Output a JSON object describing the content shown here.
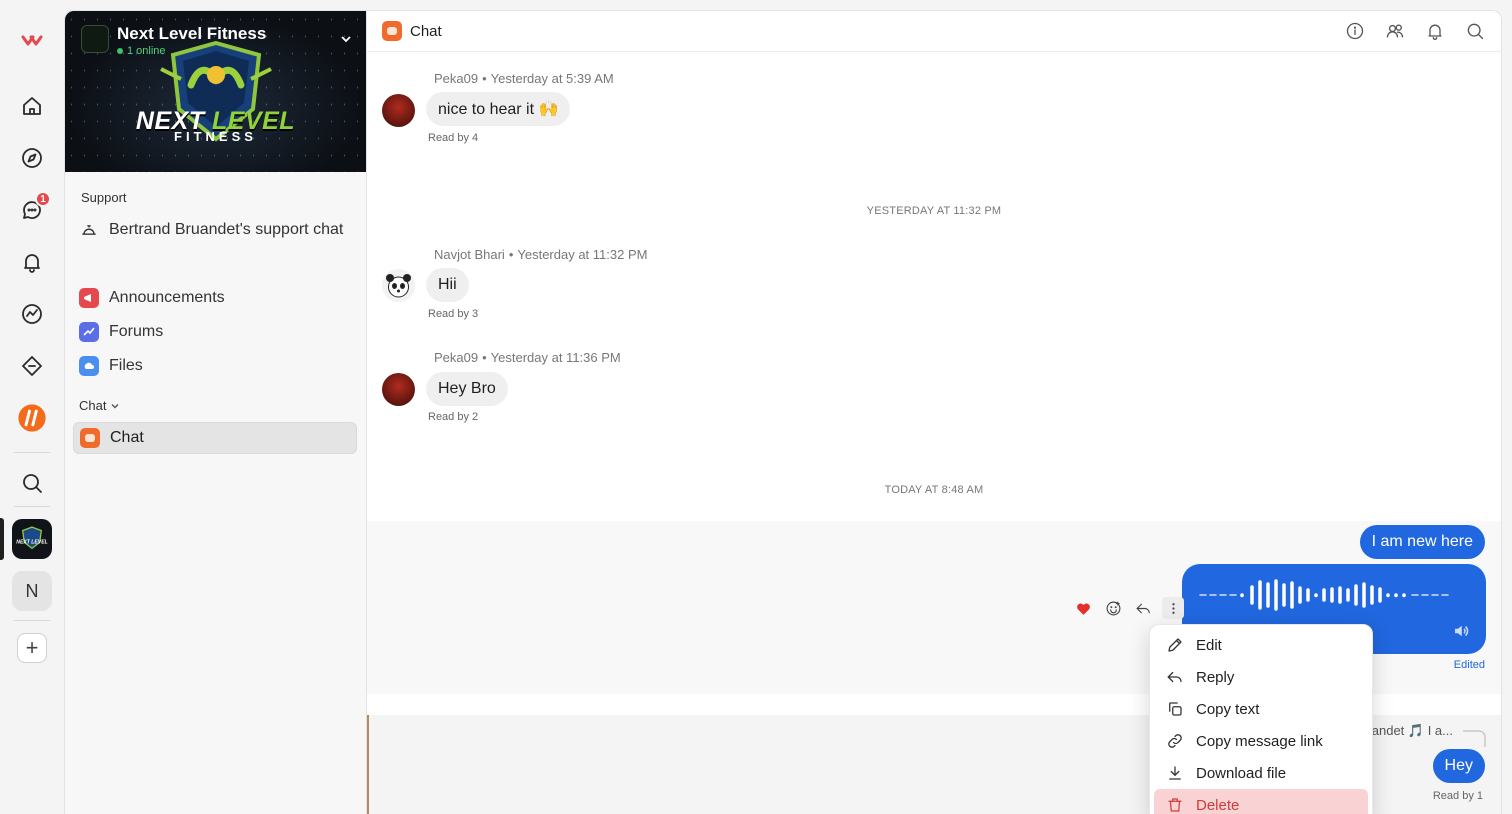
{
  "rail": {
    "notification_count": "1",
    "server_letter": "N",
    "add_label": "+"
  },
  "server": {
    "name": "Next Level Fitness",
    "online": "1 online",
    "logo_line1_a": "NEXT ",
    "logo_line1_b": "LEVEL",
    "logo_line2": "FITNESS"
  },
  "sidebar": {
    "support_label": "Support",
    "support_chat": "Bertrand Bruandet's support chat",
    "channels": [
      {
        "label": "Announcements",
        "icon": "megaphone-icon",
        "color": "#e5484d"
      },
      {
        "label": "Forums",
        "icon": "forum-icon",
        "color": "#5b6ee8"
      },
      {
        "label": "Files",
        "icon": "cloud-icon",
        "color": "#4a8ff0"
      }
    ],
    "chat_group": "Chat",
    "chat_item": "Chat"
  },
  "header": {
    "title": "Chat"
  },
  "messages": [
    {
      "author": "Peka09",
      "time": "Yesterday at 5:39 AM",
      "text": "nice to hear it 🙌",
      "read": "Read by 4"
    },
    {
      "author": "Navjot Bhari",
      "time": "Yesterday at 11:32 PM",
      "text": "Hii",
      "read": "Read by 3"
    },
    {
      "author": "Peka09",
      "time": "Yesterday at 11:36 PM",
      "text": "Hey Bro",
      "read": "Read by 2"
    }
  ],
  "dividers": {
    "first": "YESTERDAY AT 11:32 PM",
    "second": "TODAY AT 8:48 AM"
  },
  "own": {
    "msg1": "I am new here",
    "edited": "Edited",
    "reply_preview": "andet 🎵 I a...",
    "msg2": "Hey",
    "read": "Read by 1"
  },
  "context_menu": {
    "items": [
      "Edit",
      "Reply",
      "Copy text",
      "Copy message link",
      "Download file",
      "Delete"
    ]
  },
  "colors": {
    "accent": "#2167df",
    "danger": "#d13b3b"
  }
}
